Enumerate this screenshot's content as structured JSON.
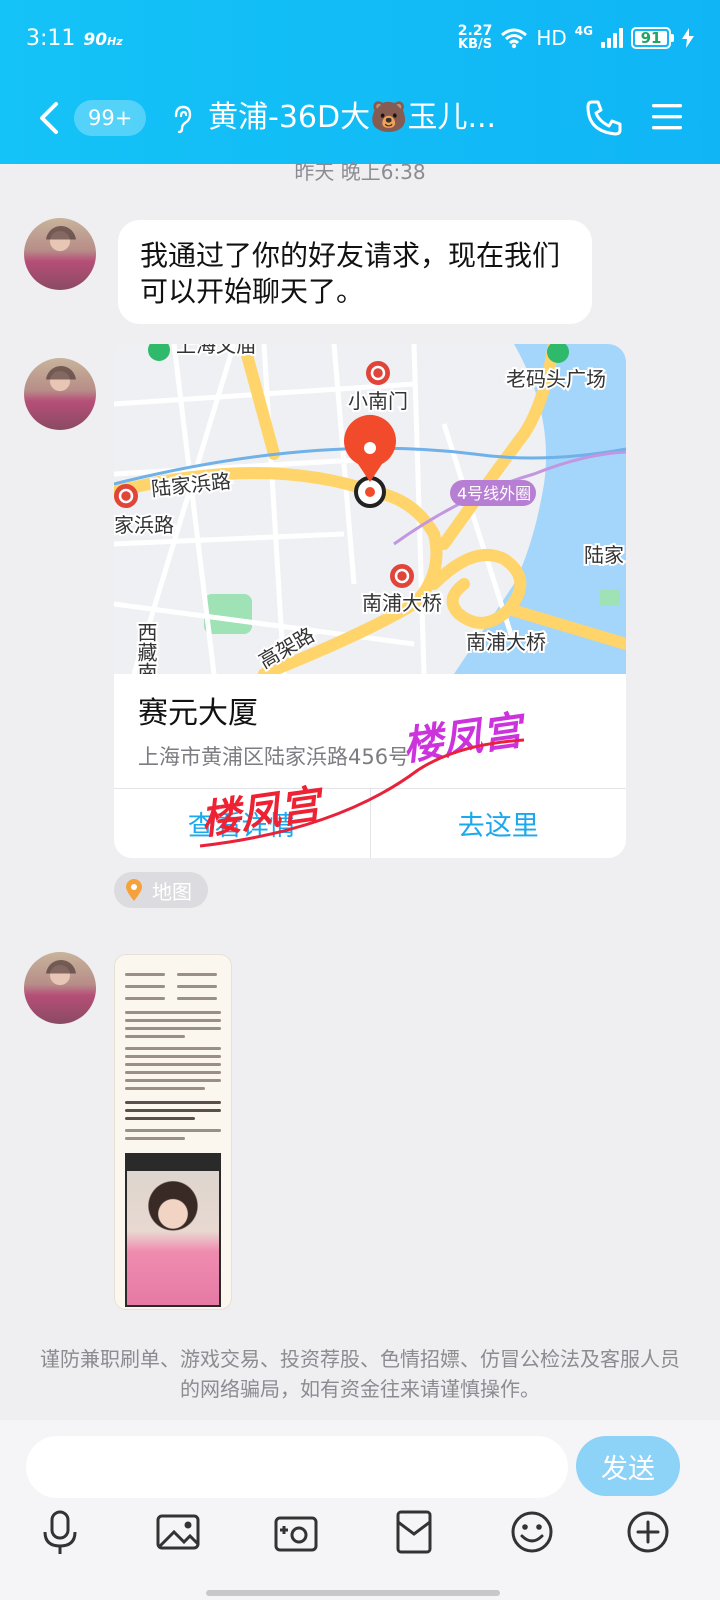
{
  "status_bar": {
    "time": "3:11",
    "refresh": "90",
    "refresh_unit": "Hz",
    "speed_value": "2.27",
    "speed_unit": "KB/S",
    "hd": "HD",
    "network": "4G",
    "battery": "91"
  },
  "header": {
    "unread_badge": "99+",
    "title": "黄浦-36D大🐻玉儿..."
  },
  "chat": {
    "timestamp": "昨天 晚上6:38",
    "text_message": "我通过了你的好友请求，现在我们可以开始聊天了。",
    "location": {
      "name": "赛元大厦",
      "address": "上海市黄浦区陆家浜路456号",
      "view_details": "查看详情",
      "go_here": "去这里",
      "map_labels": [
        "上海文庙",
        "小南门",
        "老码头广场",
        "陆家浜路",
        "家浜路",
        "4号线外圈",
        "陆家",
        "南浦大桥",
        "南浦大桥",
        "西藏南",
        "高架路"
      ]
    },
    "watermark": "楼凤宫",
    "map_tag": "地图",
    "notice": "谨防兼职刷单、游戏交易、投资荐股、色情招嫖、仿冒公检法及客服人员的网络骗局，如有资金往来请谨慎操作。"
  },
  "input_bar": {
    "placeholder": "",
    "send_label": "发送",
    "tools": [
      "microphone-icon",
      "photo-icon",
      "camera-icon",
      "red-packet-icon",
      "emoji-icon",
      "plus-icon"
    ]
  }
}
